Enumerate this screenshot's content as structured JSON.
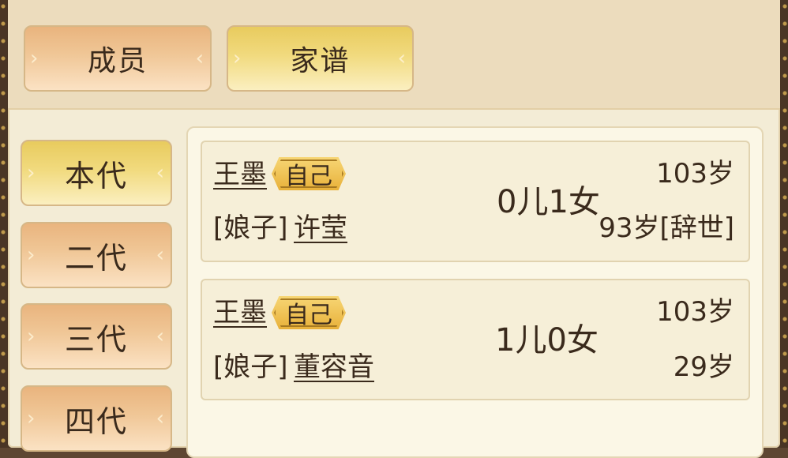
{
  "tabs": [
    {
      "label": "成员",
      "active": false
    },
    {
      "label": "家谱",
      "active": true
    }
  ],
  "generations": [
    {
      "label": "本代",
      "active": true
    },
    {
      "label": "二代",
      "active": false
    },
    {
      "label": "三代",
      "active": false
    },
    {
      "label": "四代",
      "active": false
    }
  ],
  "records": [
    {
      "name": "王墨",
      "self_badge": "自己",
      "spouse_prefix": "[娘子]",
      "spouse_name": "许莹",
      "children": "0儿1女",
      "age": "103岁",
      "spouse_age": "93岁[辞世]"
    },
    {
      "name": "王墨",
      "self_badge": "自己",
      "spouse_prefix": "[娘子]",
      "spouse_name": "董容音",
      "children": "1儿0女",
      "age": "103岁",
      "spouse_age": "29岁"
    }
  ],
  "colors": {
    "active_button": "#f1da7e",
    "inactive_button": "#f0c797",
    "panel": "#f3ecd6",
    "text": "#3a2a1c"
  }
}
